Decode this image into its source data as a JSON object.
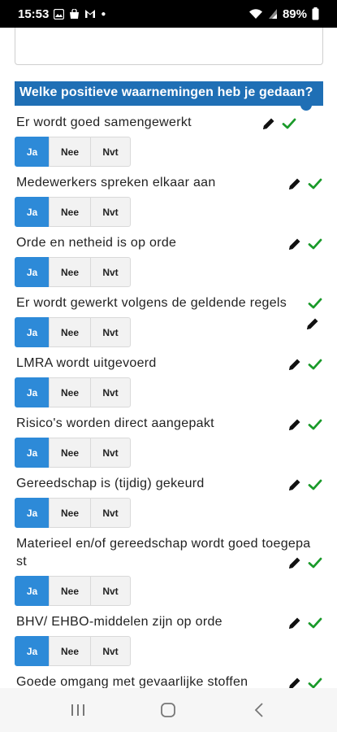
{
  "status_bar": {
    "time": "15:53",
    "battery": "89%",
    "icons": [
      "image-icon",
      "shop-icon",
      "gmail-icon",
      "wifi-icon",
      "signal-icon",
      "battery-icon"
    ]
  },
  "section": {
    "title": "Welke positieve waarnemingen heb je gedaan?"
  },
  "options": [
    "Ja",
    "Nee",
    "Nvt"
  ],
  "questions": [
    {
      "label": "Er wordt goed samengewerkt",
      "selected": "Ja"
    },
    {
      "label": "Medewerkers spreken elkaar aan",
      "selected": "Ja"
    },
    {
      "label": "Orde en netheid is op orde",
      "selected": "Ja"
    },
    {
      "label": "Er wordt gewerkt volgens de geldende regels",
      "selected": "Ja"
    },
    {
      "label": "LMRA wordt uitgevoerd",
      "selected": "Ja"
    },
    {
      "label": "Risico's worden direct aangepakt",
      "selected": "Ja"
    },
    {
      "label": "Gereedschap is (tijdig) gekeurd",
      "selected": "Ja"
    },
    {
      "label": "Materieel en/of gereedschap wordt goed toegepa st",
      "selected": "Ja"
    },
    {
      "label": "BHV/ EHBO-middelen zijn op orde",
      "selected": "Ja"
    },
    {
      "label": "Goede omgang met gevaarlijke stoffen",
      "selected": ""
    }
  ],
  "colors": {
    "header_bg": "#1f6fb5",
    "active_btn": "#2d8ad8",
    "check_green": "#1a9a2a"
  }
}
